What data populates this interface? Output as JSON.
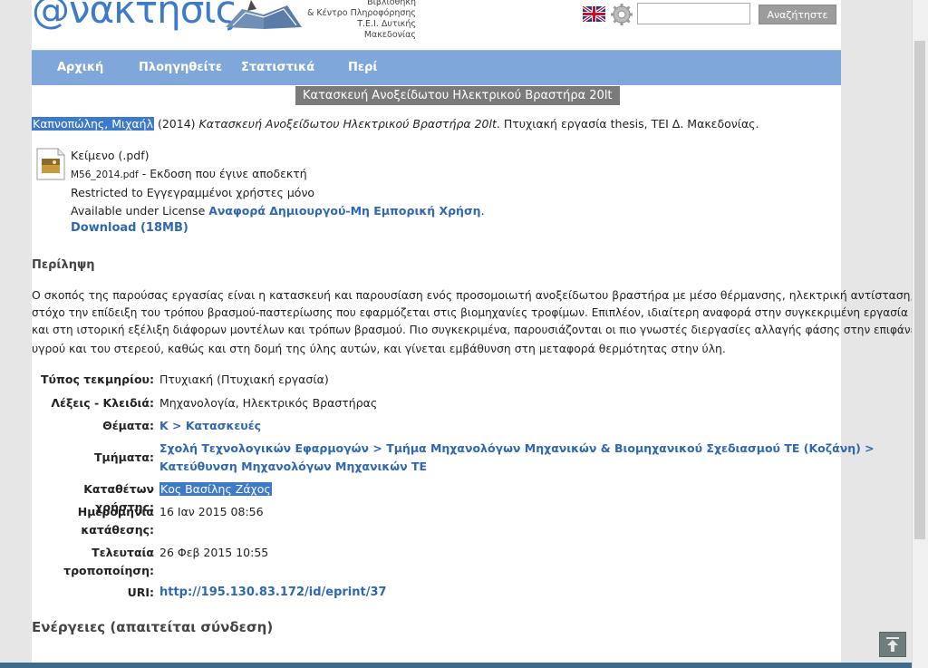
{
  "header": {
    "logo_text": "@νάκτησις",
    "logo_sub": [
      "Βιβλιοθήκη",
      "& Κέντρο Πληροφόρησης",
      "Τ.Ε.Ι. Δυτικής Μακεδονίας"
    ],
    "search_value": "",
    "search_button": "Αναζήτηστε"
  },
  "nav": [
    "Αρχική",
    "Πλοηγηθείτε",
    "Στατιστικά",
    "Περί"
  ],
  "title_tab": "Κατασκευή Ανοξείδωτου Ηλεκτρικού Βραστήρα 20lt",
  "citation": {
    "author": "Καπνοπώλης, Μιχαήλ",
    "year": " (2014) ",
    "title": "Κατασκευή Ανοξείδωτου Ηλεκτρικού Βραστήρα 20lt",
    "rest": ". Πτυχιακή εργασία thesis, ΤΕΙ Δ. Μακεδονίας."
  },
  "file": {
    "name": "Κείμενο (.pdf)",
    "filename": "M56_2014.pdf",
    "version": " - Εκδοση που έγινε αποδεκτή",
    "restricted": "Restricted to Εγγεγραμμένοι χρήστες μόνο",
    "license_prefix": "Available under License ",
    "license_link": "Αναφορά Δημιουργού-Μη Εμπορική Χρήση",
    "license_suffix": ".",
    "download": "Download (18MB)"
  },
  "abstract_heading": "Περίληψη",
  "abstract_lines": [
    "Ο σκοπός της παρούσας εργασίας είναι η κατασκευή και παρουσίαση ενός προσομοιωτή ανοξείδωτου βραστήρα με μέσο θέρμανσης, ηλεκτρική αντίσταση, με",
    "στόχο την επίδειξη του τρόπου βρασμού-παστερίωσης που εφαρμόζεται στις βιομηχανίες τροφίμων. Επιπλέον, ιδιαίτερη αναφορά στην συγκεκριμένη εργασία γίνεται",
    "και στη ιστορική εξέλιξη διάφορων μοντέλων και τρόπων βρασμού. Πιο συγκεκριμένα, παρουσιάζονται οι πιο γνωστές διεργασίες αλλαγής φάσης στην επιφάνεια του",
    "υγρού και του στερεού, καθώς και στη δομή της ύλης αυτών, και γίνεται εμβάθυνση στη μεταφορά θερμότητας στην ύλη."
  ],
  "meta": {
    "type_label": "Τύπος τεκμηρίου:",
    "type_value": "Πτυχιακή (Πτυχιακή εργασία)",
    "keywords_label": "Λέξεις - Κλειδιά:",
    "keywords_value": "Μηχανολογία, Ηλεκτρικός Βραστήρας",
    "subjects_label": "Θέματα:",
    "subjects_value": "K > Κατασκευές",
    "depts_label": "Τμήματα:",
    "depts_line1": "Σχολή Τεχνολογικών Εφαρμογών > Τμήμα Μηχανολόγων Μηχανικών & Βιομηχανικού Σχεδιασμού ΤΕ (Κοζάνη) >",
    "depts_line2": "Κατεύθυνση Μηχανολόγων Μηχανικών ΤΕ",
    "depositor_label": "Καταθέτων χρήστης:",
    "depositor_value": "Κος Βασίλης Ζάχος",
    "deposit_label_1": "Ημερομηνία",
    "deposit_label_2": "κατάθεσης:",
    "deposit_value": "16 Ιαν 2015 08:56",
    "modified_label_1": "Τελευταία",
    "modified_label_2": "τροποποίηση:",
    "modified_value": "26 Φεβ 2015 10:55",
    "uri_label": "URI:",
    "uri_value": "http://195.130.83.172/id/eprint/37"
  },
  "actions_heading": "Ενέργειες (απαιτείται σύνδεση)",
  "colors": {
    "nav": "#7fa7d9",
    "link": "#2f67b3",
    "highlight": "#3d7ac9"
  }
}
